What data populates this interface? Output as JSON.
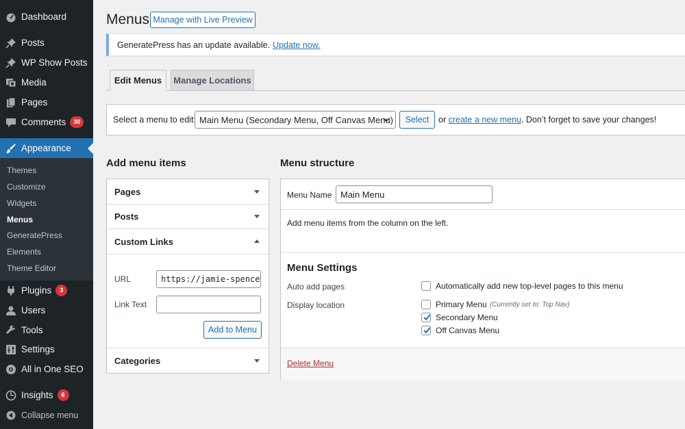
{
  "sidebar": {
    "items": [
      {
        "label": "Dashboard",
        "icon": "dashboard-icon"
      },
      {
        "label": "Posts",
        "icon": "pin-icon"
      },
      {
        "label": "WP Show Posts",
        "icon": "pin-icon"
      },
      {
        "label": "Media",
        "icon": "media-icon"
      },
      {
        "label": "Pages",
        "icon": "pages-icon"
      },
      {
        "label": "Comments",
        "icon": "comment-icon",
        "badge": "30"
      },
      {
        "label": "Appearance",
        "icon": "brush-icon"
      },
      {
        "label": "Plugins",
        "icon": "plugin-icon",
        "badge": "3"
      },
      {
        "label": "Users",
        "icon": "user-icon"
      },
      {
        "label": "Tools",
        "icon": "wrench-icon"
      },
      {
        "label": "Settings",
        "icon": "settings-icon"
      },
      {
        "label": "All in One SEO",
        "icon": "seo-icon"
      },
      {
        "label": "Insights",
        "icon": "insights-icon",
        "badge": "6"
      },
      {
        "label": "Collapse menu",
        "icon": "collapse-icon"
      }
    ],
    "submenu": [
      "Themes",
      "Customize",
      "Widgets",
      "Menus",
      "GeneratePress",
      "Elements",
      "Theme Editor"
    ]
  },
  "header": {
    "title": "Menus",
    "live_preview": "Manage with Live Preview"
  },
  "notice": {
    "text": "GeneratePress has an update available.",
    "link": "Update now."
  },
  "tabs": [
    "Edit Menus",
    "Manage Locations"
  ],
  "select_bar": {
    "label": "Select a menu to edit:",
    "selected": "Main Menu (Secondary Menu, Off Canvas Menu)",
    "button": "Select",
    "or": "or",
    "create_link": "create a new menu",
    "reminder": ". Don’t forget to save your changes!"
  },
  "add_items": {
    "heading": "Add menu items",
    "sections": [
      "Pages",
      "Posts",
      "Custom Links",
      "Categories"
    ],
    "url_label": "URL",
    "url_value": "https://jamie-spencer",
    "link_text_label": "Link Text",
    "link_text_value": "",
    "add_button": "Add to Menu"
  },
  "structure": {
    "heading": "Menu structure",
    "menu_name_label": "Menu Name",
    "menu_name_value": "Main Menu",
    "instructions": "Add menu items from the column on the left.",
    "settings_heading": "Menu Settings",
    "auto_add_label": "Auto add pages",
    "auto_add_option": "Automatically add new top-level pages to this menu",
    "display_location_label": "Display location",
    "locations": [
      {
        "label": "Primary Menu",
        "note": "(Currently set to: Top Nav)",
        "checked": false
      },
      {
        "label": "Secondary Menu",
        "note": "",
        "checked": true
      },
      {
        "label": "Off Canvas Menu",
        "note": "",
        "checked": true
      }
    ],
    "auto_add_checked": false,
    "delete_link": "Delete Menu"
  },
  "colors": {
    "sidebar_bg": "#1d2327",
    "accent": "#2271b1",
    "badge": "#d63638",
    "delete": "#b32d2e"
  }
}
